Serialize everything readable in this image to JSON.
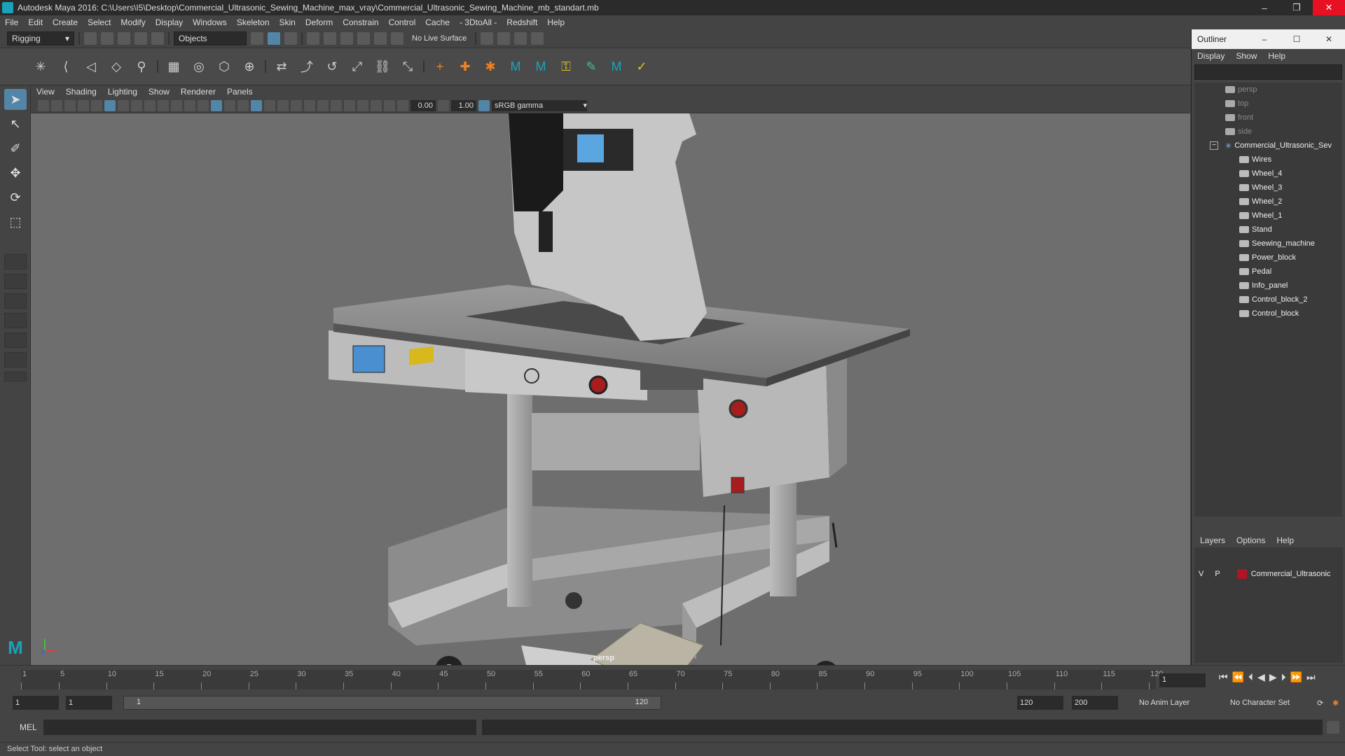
{
  "window": {
    "title": "Autodesk Maya 2016: C:\\Users\\I5\\Desktop\\Commercial_Ultrasonic_Sewing_Machine_max_vray\\Commercial_Ultrasonic_Sewing_Machine_mb_standart.mb"
  },
  "menu": [
    "File",
    "Edit",
    "Create",
    "Select",
    "Modify",
    "Display",
    "Windows",
    "Skeleton",
    "Skin",
    "Deform",
    "Constrain",
    "Control",
    "Cache",
    "- 3DtoAll -",
    "Redshift",
    "Help"
  ],
  "toolbar": {
    "mode": "Rigging",
    "selection_mask": "Objects",
    "live_surface": "No Live Surface"
  },
  "viewport": {
    "menu": [
      "View",
      "Shading",
      "Lighting",
      "Show",
      "Renderer",
      "Panels"
    ],
    "exposure": "0.00",
    "gamma": "1.00",
    "color_space": "sRGB gamma",
    "camera": "persp"
  },
  "outliner": {
    "title": "Outliner",
    "menu": [
      "Display",
      "Show",
      "Help"
    ],
    "cameras": [
      "persp",
      "top",
      "front",
      "side"
    ],
    "root": "Commercial_Ultrasonic_Sev",
    "children": [
      "Wires",
      "Wheel_4",
      "Wheel_3",
      "Wheel_2",
      "Wheel_1",
      "Stand",
      "Seewing_machine",
      "Power_block",
      "Pedal",
      "Info_panel",
      "Control_block_2",
      "Control_block"
    ]
  },
  "layers": {
    "menu": [
      "Layers",
      "Options",
      "Help"
    ],
    "v": "V",
    "p": "P",
    "name": "Commercial_Ultrasonic"
  },
  "timeline": {
    "ticks": [
      "1",
      "5",
      "10",
      "15",
      "20",
      "25",
      "30",
      "35",
      "40",
      "45",
      "50",
      "55",
      "60",
      "65",
      "70",
      "75",
      "80",
      "85",
      "90",
      "95",
      "100",
      "105",
      "110",
      "115",
      "120"
    ],
    "current_frame": "1"
  },
  "range": {
    "start": "1",
    "playback_start": "1",
    "slider_start": "1",
    "slider_end": "120",
    "playback_end": "120",
    "end": "200",
    "anim_layer": "No Anim Layer",
    "char_set": "No Character Set"
  },
  "command": {
    "label": "MEL"
  },
  "status": {
    "text": "Select Tool: select an object"
  }
}
